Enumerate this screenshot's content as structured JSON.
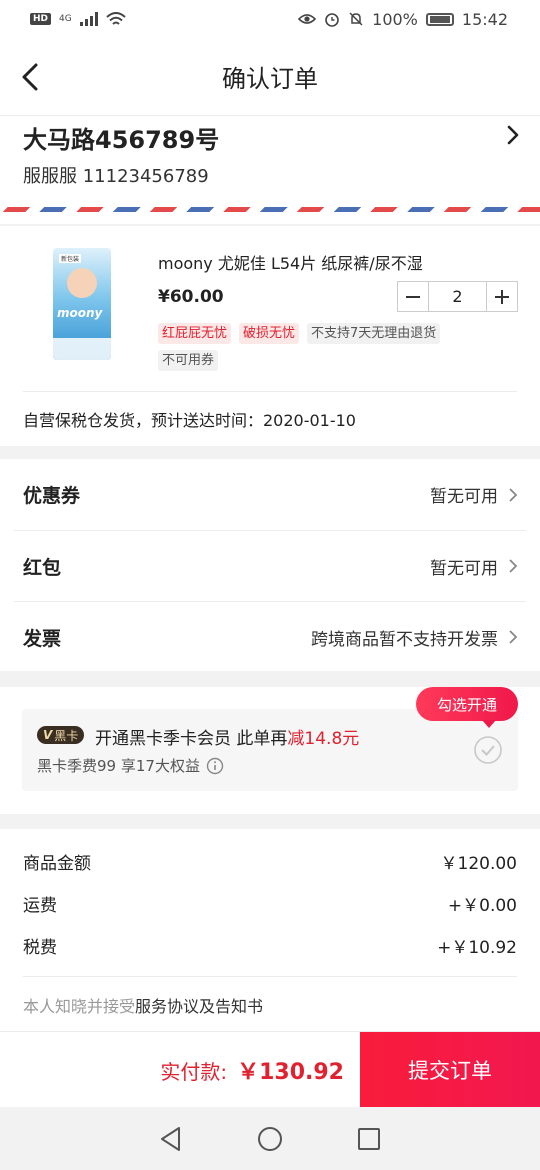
{
  "status_bar": {
    "network_badge": "HD",
    "signal_label": "4G",
    "battery_percent": "100%",
    "time": "15:42",
    "icons": [
      "hd-icon",
      "signal-icon",
      "wifi-icon",
      "eye-icon",
      "alarm-icon",
      "mute-icon",
      "battery-icon"
    ]
  },
  "header": {
    "title": "确认订单",
    "back_icon": "chevron-left-icon"
  },
  "address": {
    "street": "大马路456789号",
    "person": "服服服  11123456789"
  },
  "product": {
    "name": "moony 尤妮佳 L54片 纸尿裤/尿不湿",
    "price": "¥60.00",
    "quantity": "2",
    "image_tag": "新包装",
    "image_brand": "moony",
    "tags": [
      {
        "text": "红屁屁无忧",
        "style": "red"
      },
      {
        "text": "破损无忧",
        "style": "red"
      },
      {
        "text": "不支持7天无理由退货",
        "style": "gray"
      },
      {
        "text": "不可用券",
        "style": "gray"
      }
    ],
    "delivery": "自营保税仓发货，预计送达时间：2020-01-10"
  },
  "options": [
    {
      "label": "优惠券",
      "value": "暂无可用"
    },
    {
      "label": "红包",
      "value": "暂无可用"
    },
    {
      "label": "发票",
      "value": "跨境商品暂不支持开发票"
    }
  ],
  "promo": {
    "badge_v": "V",
    "badge_text": "黑卡",
    "title_prefix": "开通黑卡季卡会员 此单再",
    "title_highlight": "减14.8元",
    "subtitle": "黑卡季费99 享17大权益",
    "callout": "勾选开通"
  },
  "summary": {
    "rows": [
      {
        "label": "商品金额",
        "value": "￥120.00"
      },
      {
        "label": "运费",
        "value": "+￥0.00"
      },
      {
        "label": "税费",
        "value": "+￥10.92"
      }
    ],
    "agreement_prefix": "本人知晓并接受",
    "agreement_link": "服务协议及告知书"
  },
  "bottom": {
    "pay_label": "实付款:",
    "pay_amount": "￥130.92",
    "submit_label": "提交订单"
  },
  "colors": {
    "accent": "#e0212f",
    "submit_bg": "#f91c3b",
    "badge_bg": "#3a2e22"
  }
}
